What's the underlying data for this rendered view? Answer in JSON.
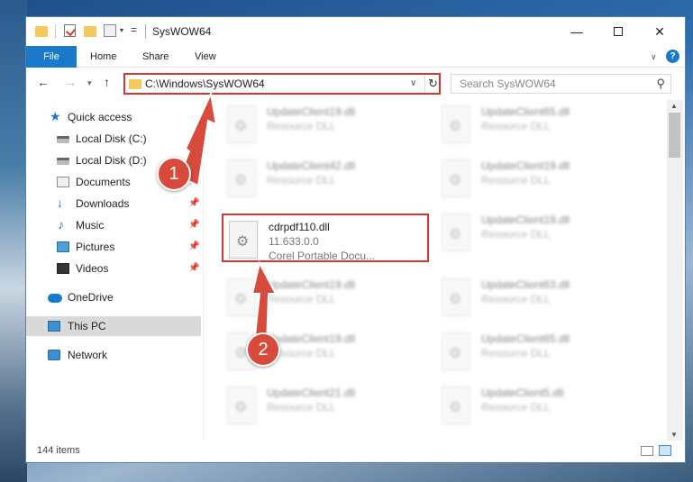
{
  "window": {
    "title": "SysWOW64",
    "controls": {
      "minimize": "—",
      "maximize": "",
      "close": "✕"
    }
  },
  "ribbon": {
    "tabs": [
      "File",
      "Home",
      "Share",
      "View"
    ],
    "help": "?"
  },
  "nav": {
    "back": "←",
    "forward": "→",
    "recent": "▾",
    "up": "↑",
    "address": "C:\\Windows\\SysWOW64",
    "refresh": "↻",
    "search_placeholder": "Search SysWOW64"
  },
  "sidebar": {
    "items": [
      {
        "label": "Quick access",
        "icon": "star-icon",
        "pinned": false
      },
      {
        "label": "Local Disk (C:)",
        "icon": "disk-icon",
        "pinned": true
      },
      {
        "label": "Local Disk (D:)",
        "icon": "disk-icon",
        "pinned": true
      },
      {
        "label": "Documents",
        "icon": "documents-icon",
        "pinned": true
      },
      {
        "label": "Downloads",
        "icon": "download-icon",
        "pinned": true
      },
      {
        "label": "Music",
        "icon": "music-icon",
        "pinned": true
      },
      {
        "label": "Pictures",
        "icon": "pictures-icon",
        "pinned": true
      },
      {
        "label": "Videos",
        "icon": "videos-icon",
        "pinned": true
      },
      {
        "label": "OneDrive",
        "icon": "cloud-icon",
        "pinned": false
      },
      {
        "label": "This PC",
        "icon": "pc-icon",
        "pinned": false,
        "selected": true
      },
      {
        "label": "Network",
        "icon": "network-icon",
        "pinned": false
      }
    ]
  },
  "files": {
    "left_column": [
      {
        "name": "UpdateClient19.dll",
        "type": "Resource DLL",
        "blurred": true
      },
      {
        "name": "UpdateClient42.dll",
        "type": "Resource DLL",
        "blurred": true
      },
      {
        "name": "cdrpdf110.dll",
        "version": "11.633.0.0",
        "type": "Corel Portable Docu...",
        "blurred": false,
        "highlighted": true
      },
      {
        "name": "UpdateClient19.dll",
        "type": "Resource DLL",
        "blurred": true
      },
      {
        "name": "UpdateClient19.dll",
        "type": "Resource DLL",
        "blurred": true
      },
      {
        "name": "UpdateClient21.dll",
        "type": "Resource DLL",
        "blurred": true
      }
    ],
    "right_column": [
      {
        "name": "UpdateClient65.dll",
        "type": "Resource DLL",
        "blurred": true
      },
      {
        "name": "UpdateClient19.dll",
        "type": "Resource DLL",
        "blurred": true
      },
      {
        "name": "UpdateClient19.dll",
        "type": "Resource DLL",
        "blurred": true
      },
      {
        "name": "UpdateClient63.dll",
        "type": "Resource DLL",
        "blurred": true
      },
      {
        "name": "UpdateClient65.dll",
        "type": "Resource DLL",
        "blurred": true
      },
      {
        "name": "UpdateClient5.dll",
        "type": "Resource DLL",
        "blurred": true
      }
    ]
  },
  "status": {
    "item_count": "144 items"
  },
  "annotations": {
    "step1": "1",
    "step2": "2"
  },
  "colors": {
    "accent": "#1979ca",
    "highlight": "#d43434",
    "badge": "#d74a3c"
  }
}
